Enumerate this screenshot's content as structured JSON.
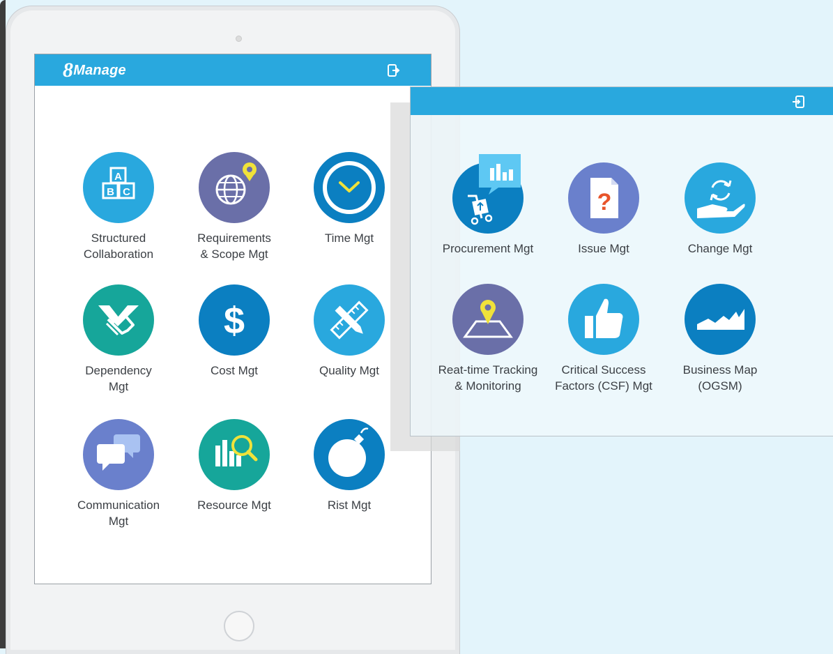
{
  "app": {
    "logo_prefix": "8",
    "logo_text": "Manage"
  },
  "tablet_tiles": [
    {
      "label_1": "Structured",
      "label_2": "Collaboration",
      "icon": "abc-blocks-icon",
      "color": "#29a8de"
    },
    {
      "label_1": "Requirements",
      "label_2": "& Scope Mgt",
      "icon": "globe-pin-icon",
      "color": "#6a6fa8"
    },
    {
      "label_1": "Time Mgt",
      "label_2": "",
      "icon": "clock-icon",
      "color": "#0b7fc1"
    },
    {
      "label_1": "Dependency",
      "label_2": "Mgt",
      "icon": "handshake-icon",
      "color": "#16a69a"
    },
    {
      "label_1": "Cost Mgt",
      "label_2": "",
      "icon": "dollar-icon",
      "color": "#0b7fc1"
    },
    {
      "label_1": "Quality Mgt",
      "label_2": "",
      "icon": "ruler-pencil-icon",
      "color": "#29a8de"
    },
    {
      "label_1": "Communication",
      "label_2": "Mgt",
      "icon": "chat-bubbles-icon",
      "color": "#6a80cc"
    },
    {
      "label_1": "Resource Mgt",
      "label_2": "",
      "icon": "bars-magnifier-icon",
      "color": "#16a69a"
    },
    {
      "label_1": "Rist Mgt",
      "label_2": "",
      "icon": "bomb-icon",
      "color": "#0b7fc1"
    }
  ],
  "panel_tiles": [
    {
      "label_1": "Procurement Mgt",
      "label_2": "",
      "icon": "cart-chart-icon",
      "color": "#0b7fc1"
    },
    {
      "label_1": "Issue Mgt",
      "label_2": "",
      "icon": "question-document-icon",
      "color": "#6a80cc"
    },
    {
      "label_1": "Change Mgt",
      "label_2": "",
      "icon": "hand-cycle-icon",
      "color": "#29a8de"
    },
    {
      "label_1": "Reat-time Tracking",
      "label_2": "& Monitoring",
      "icon": "map-pin-icon",
      "color": "#6a6fa8"
    },
    {
      "label_1": "Critical Success",
      "label_2": "Factors (CSF) Mgt",
      "icon": "thumbs-up-icon",
      "color": "#29a8de"
    },
    {
      "label_1": "Business Map",
      "label_2": "(OGSM)",
      "icon": "area-chart-icon",
      "color": "#0b7fc1"
    }
  ],
  "icons": {
    "exit": "logout-icon",
    "enter": "login-icon"
  }
}
